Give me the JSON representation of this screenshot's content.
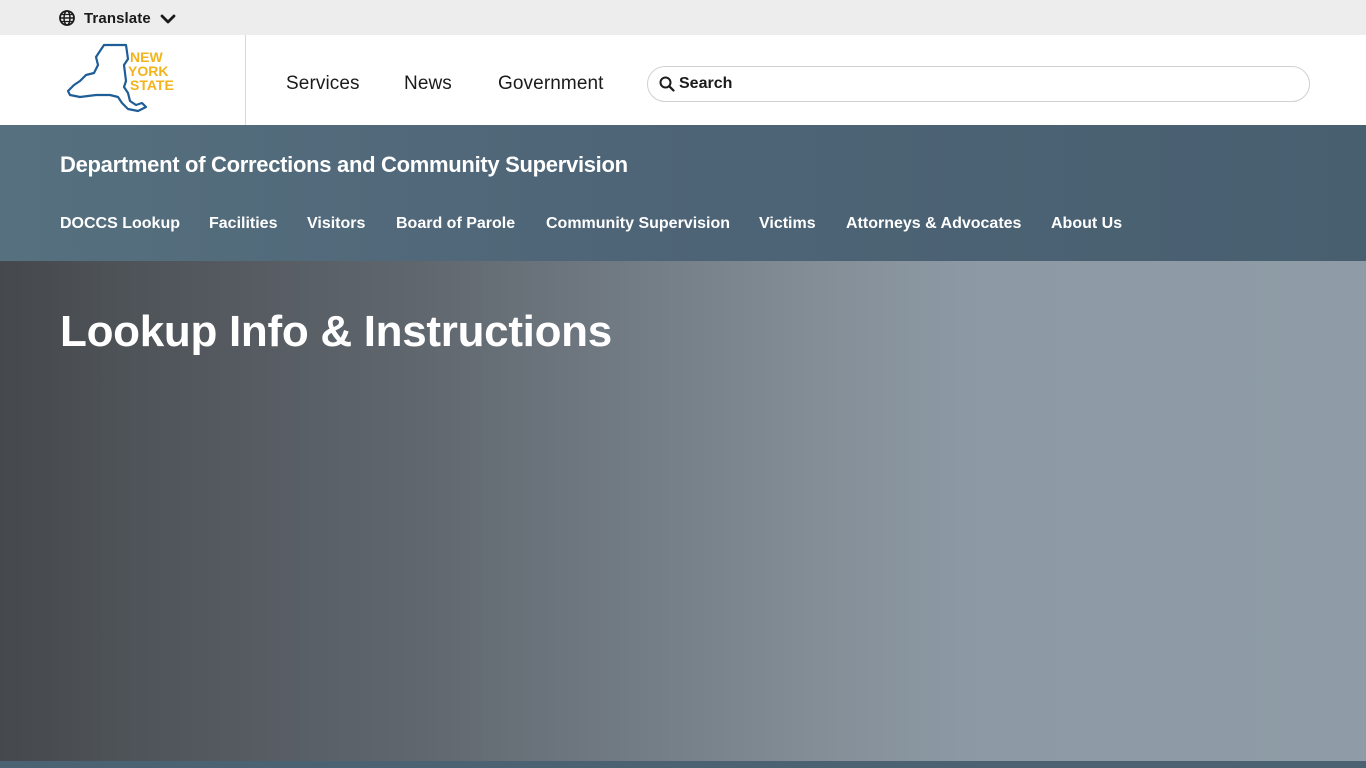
{
  "translate": {
    "label": "Translate",
    "icon": "globe-icon",
    "toggle_icon": "chevron-down-icon"
  },
  "logo": {
    "line1": "NEW",
    "line2": "YORK",
    "line3": "STATE",
    "brand_blue": "#1f5d96",
    "brand_gold": "#f3b41b"
  },
  "global_nav": [
    {
      "label": "Services"
    },
    {
      "label": "News"
    },
    {
      "label": "Government"
    }
  ],
  "search": {
    "placeholder": "Search",
    "icon": "search-icon"
  },
  "agency": {
    "title": "Department of Corrections and Community Supervision",
    "nav": [
      {
        "label": "DOCCS Lookup"
      },
      {
        "label": "Facilities"
      },
      {
        "label": "Visitors"
      },
      {
        "label": "Board of Parole"
      },
      {
        "label": "Community Supervision"
      },
      {
        "label": "Victims"
      },
      {
        "label": "Attorneys & Advocates"
      },
      {
        "label": "About Us"
      }
    ]
  },
  "hero": {
    "title": "Lookup Info & Instructions"
  },
  "colors": {
    "agency_bar": "#4e6577",
    "translate_bar": "#ededed",
    "hero_dark": "#45484c",
    "hero_light": "#8f9ca7"
  }
}
